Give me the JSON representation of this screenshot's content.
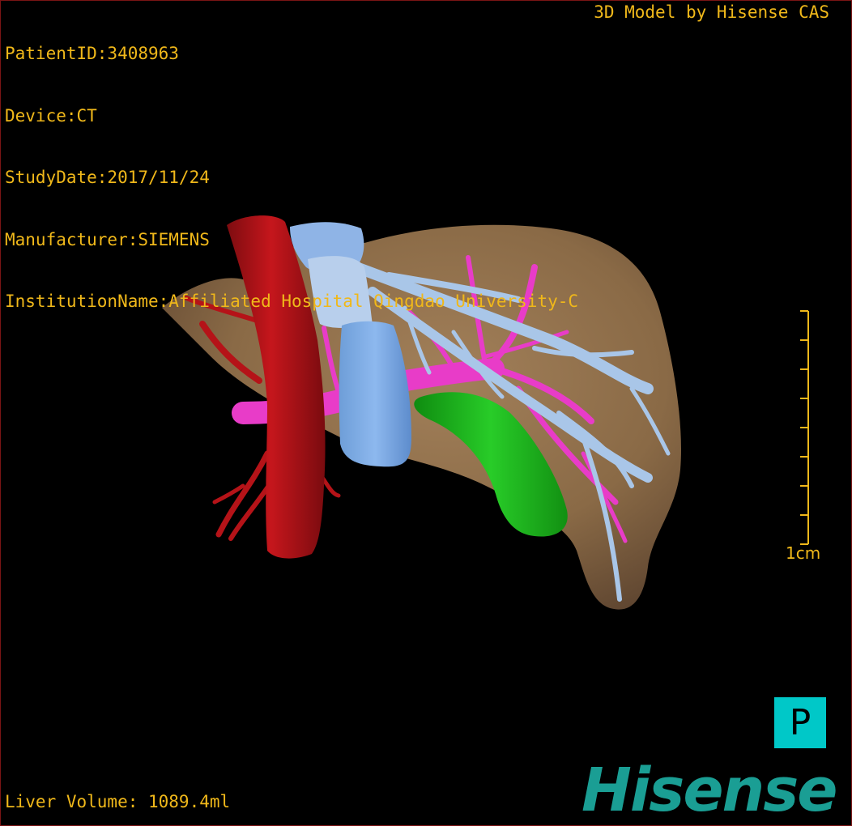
{
  "info": {
    "patient_id": "PatientID:3408963",
    "device": "Device:CT",
    "study_date": "StudyDate:2017/11/24",
    "manufacturer": "Manufacturer:SIEMENS",
    "institution": "InstitutionName:Affiliated Hospital Qingdao University-C"
  },
  "model_credit": "3D Model by Hisense CAS",
  "liver_volume": "Liver Volume: 1089.4ml",
  "scale_bar": {
    "label": "1cm",
    "ticks": 9
  },
  "orientation_button": "P",
  "logo_text": "Hisense",
  "colors": {
    "text": "#f0b81a",
    "liver": "#8a6a46",
    "artery_ivc": "#b51318",
    "portal_vein": "#e83cc8",
    "hepatic_vein": "#a9c6e8",
    "gallbladder": "#1fb81f",
    "orientation_button_bg": "#00c8c8",
    "logo": "#1a9e94"
  }
}
